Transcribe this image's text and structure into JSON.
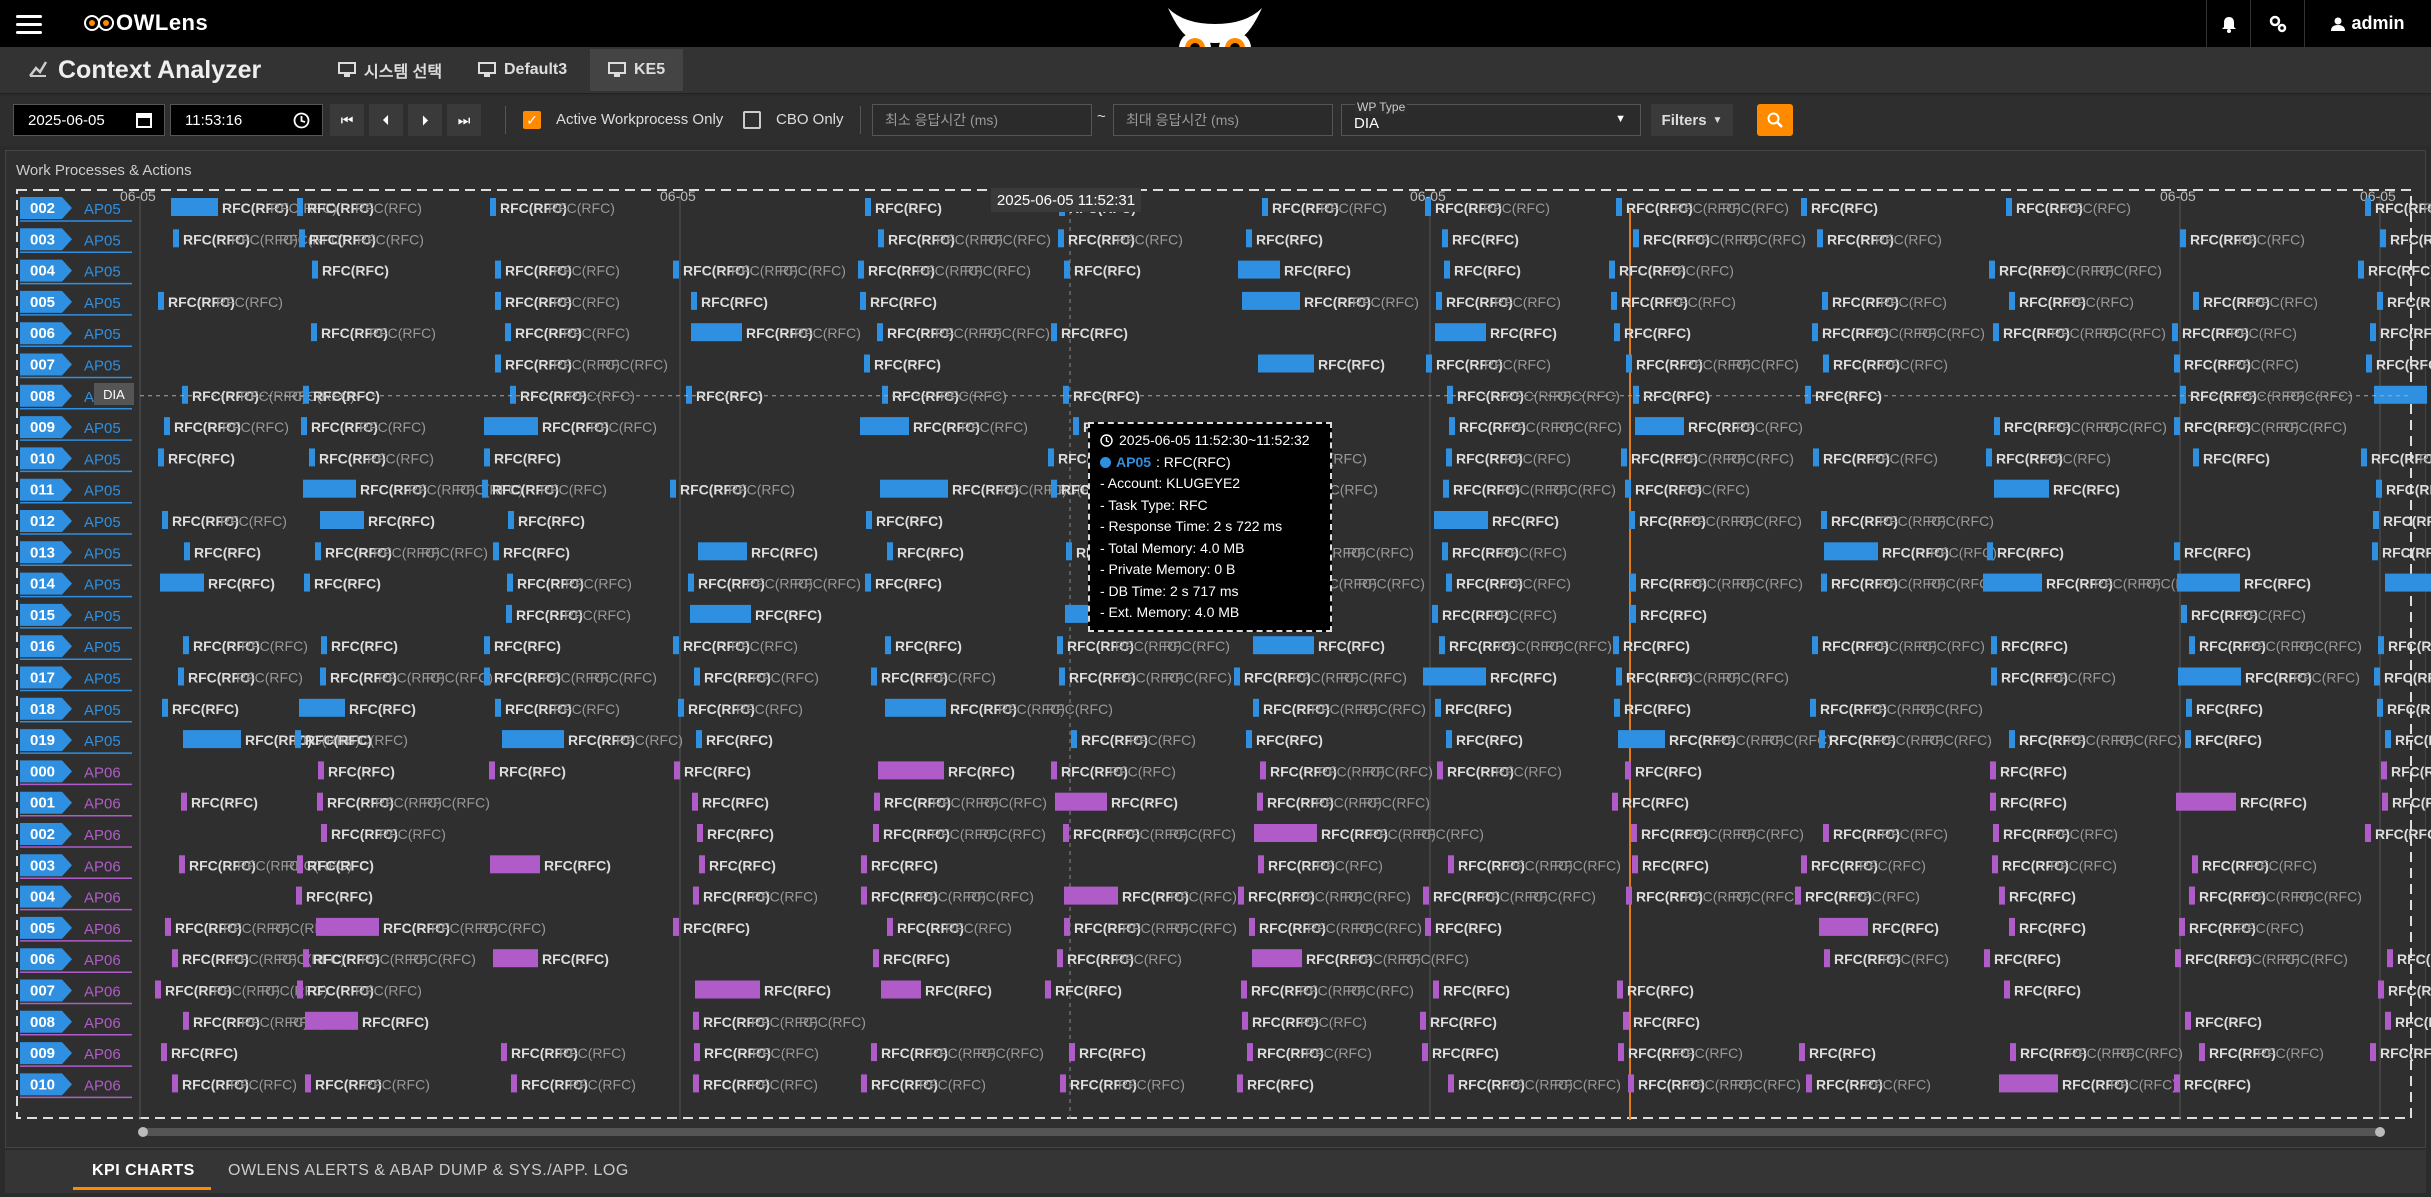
{
  "app": {
    "brand": "OWLens",
    "bell_icon": "bell-icon",
    "settings_icon": "gear-icon",
    "user_label": "admin"
  },
  "header": {
    "title": "Context Analyzer",
    "breadcrumbs": [
      {
        "label": "시스템 선택"
      },
      {
        "label": "Default3"
      },
      {
        "label": "KE5"
      }
    ]
  },
  "toolbar": {
    "date": "2025-06-05",
    "time": "11:53:16",
    "active_only_label": "Active Workprocess Only",
    "active_only_checked": true,
    "cbo_only_label": "CBO Only",
    "cbo_only_checked": false,
    "min_resp_placeholder": "최소 응답시간 (ms)",
    "tilde": "~",
    "max_resp_placeholder": "최대 응답시간 (ms)",
    "wp_type_label": "WP Type",
    "wp_type_value": "DIA",
    "filters_label": "Filters"
  },
  "panel": {
    "title": "Work Processes & Actions",
    "time_marker": "2025-06-05 11:52:31",
    "row_hover_type": "DIA"
  },
  "chart_data": {
    "type": "timeline",
    "axis_labels": [
      "06-05",
      "06-05",
      "06-05",
      "06-05",
      "06-05"
    ],
    "bar_label": "RFC(RFC)",
    "rows": [
      {
        "wp": "002",
        "server": "AP05"
      },
      {
        "wp": "003",
        "server": "AP05"
      },
      {
        "wp": "004",
        "server": "AP05"
      },
      {
        "wp": "005",
        "server": "AP05"
      },
      {
        "wp": "006",
        "server": "AP05"
      },
      {
        "wp": "007",
        "server": "AP05"
      },
      {
        "wp": "008",
        "server": "AP05"
      },
      {
        "wp": "009",
        "server": "AP05"
      },
      {
        "wp": "010",
        "server": "AP05"
      },
      {
        "wp": "011",
        "server": "AP05"
      },
      {
        "wp": "012",
        "server": "AP05"
      },
      {
        "wp": "013",
        "server": "AP05"
      },
      {
        "wp": "014",
        "server": "AP05"
      },
      {
        "wp": "015",
        "server": "AP05"
      },
      {
        "wp": "016",
        "server": "AP05"
      },
      {
        "wp": "017",
        "server": "AP05"
      },
      {
        "wp": "018",
        "server": "AP05"
      },
      {
        "wp": "019",
        "server": "AP05"
      },
      {
        "wp": "000",
        "server": "AP06"
      },
      {
        "wp": "001",
        "server": "AP06"
      },
      {
        "wp": "002",
        "server": "AP06"
      },
      {
        "wp": "003",
        "server": "AP06"
      },
      {
        "wp": "004",
        "server": "AP06"
      },
      {
        "wp": "005",
        "server": "AP06"
      },
      {
        "wp": "006",
        "server": "AP06"
      },
      {
        "wp": "007",
        "server": "AP06"
      },
      {
        "wp": "008",
        "server": "AP06"
      },
      {
        "wp": "009",
        "server": "AP06"
      },
      {
        "wp": "010",
        "server": "AP06"
      }
    ],
    "colors": {
      "AP05": "#2f8fe0",
      "AP06": "#b05cc8",
      "marker": "#e07b1a"
    }
  },
  "tooltip": {
    "range": "2025-06-05 11:52:30~11:52:32",
    "server": "AP05",
    "task": ": RFC(RFC)",
    "lines": [
      "- Account: KLUGEYE2",
      "- Task Type: RFC",
      "- Response Time: 2 s 722 ms",
      "- Total Memory: 4.0 MB",
      "- Private Memory: 0 B",
      "- DB Time: 2 s 717 ms",
      "- Ext. Memory: 4.0 MB"
    ]
  },
  "bottom_tabs": [
    {
      "label": "KPI CHARTS",
      "active": true
    },
    {
      "label": "OWLENS ALERTS & ABAP DUMP & SYS./APP. LOG",
      "active": false
    }
  ]
}
